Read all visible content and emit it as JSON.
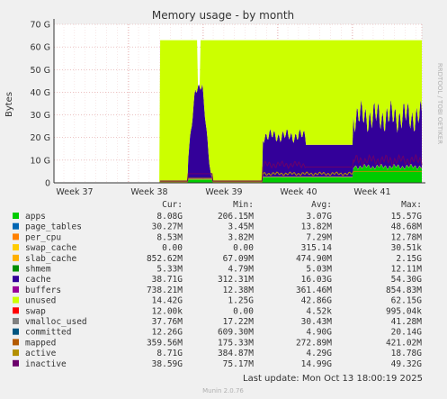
{
  "chart_data": {
    "type": "area",
    "title": "Memory usage - by month",
    "ylabel": "Bytes",
    "side_label": "RRDTOOL / TOBI OETIKER",
    "ylim": [
      0,
      70
    ],
    "y_unit": "G",
    "yticks": [
      "0",
      "10 G",
      "20 G",
      "30 G",
      "40 G",
      "50 G",
      "60 G",
      "70 G"
    ],
    "xticks": [
      "Week 37",
      "Week 38",
      "Week 39",
      "Week 40",
      "Week 41"
    ],
    "grid": true,
    "legend_headers": [
      "Cur:",
      "Min:",
      "Avg:",
      "Max:"
    ],
    "series": [
      {
        "name": "apps",
        "color": "#00cc00",
        "cur": "8.08G",
        "min": "206.15M",
        "avg": "3.07G",
        "max": "15.57G"
      },
      {
        "name": "page_tables",
        "color": "#0066b3",
        "cur": "30.27M",
        "min": "3.45M",
        "avg": "13.82M",
        "max": "48.68M"
      },
      {
        "name": "per_cpu",
        "color": "#ff8000",
        "cur": "8.53M",
        "min": "3.82M",
        "avg": "7.29M",
        "max": "12.78M"
      },
      {
        "name": "swap_cache",
        "color": "#ffcc00",
        "cur": "0.00",
        "min": "0.00",
        "avg": "315.14",
        "max": "30.51k"
      },
      {
        "name": "slab_cache",
        "color": "#ffb000",
        "cur": "852.62M",
        "min": "67.09M",
        "avg": "474.90M",
        "max": "2.15G"
      },
      {
        "name": "shmem",
        "color": "#008f00",
        "cur": "5.33M",
        "min": "4.79M",
        "avg": "5.03M",
        "max": "12.11M"
      },
      {
        "name": "cache",
        "color": "#330099",
        "cur": "38.71G",
        "min": "312.31M",
        "avg": "16.03G",
        "max": "54.30G"
      },
      {
        "name": "buffers",
        "color": "#990099",
        "cur": "738.21M",
        "min": "12.38M",
        "avg": "361.46M",
        "max": "854.83M"
      },
      {
        "name": "unused",
        "color": "#ccff00",
        "cur": "14.42G",
        "min": "1.25G",
        "avg": "42.86G",
        "max": "62.15G"
      },
      {
        "name": "swap",
        "color": "#ff0000",
        "cur": "12.00k",
        "min": "0.00",
        "avg": "4.52k",
        "max": "995.04k"
      },
      {
        "name": "vmalloc_used",
        "color": "#808080",
        "cur": "37.76M",
        "min": "17.22M",
        "avg": "30.43M",
        "max": "41.28M"
      },
      {
        "name": "committed",
        "color": "#005580",
        "cur": "12.26G",
        "min": "609.30M",
        "avg": "4.90G",
        "max": "20.14G"
      },
      {
        "name": "mapped",
        "color": "#b35a00",
        "cur": "359.56M",
        "min": "175.33M",
        "avg": "272.89M",
        "max": "421.02M"
      },
      {
        "name": "active",
        "color": "#b38f00",
        "cur": "8.71G",
        "min": "384.87M",
        "avg": "4.29G",
        "max": "18.78G"
      },
      {
        "name": "inactive",
        "color": "#6b006b",
        "cur": "38.59G",
        "min": "75.17M",
        "avg": "14.99G",
        "max": "49.32G"
      }
    ],
    "last_update": "Last update: Mon Oct 13 18:00:19 2025",
    "footer": "Munin 2.0.76"
  }
}
